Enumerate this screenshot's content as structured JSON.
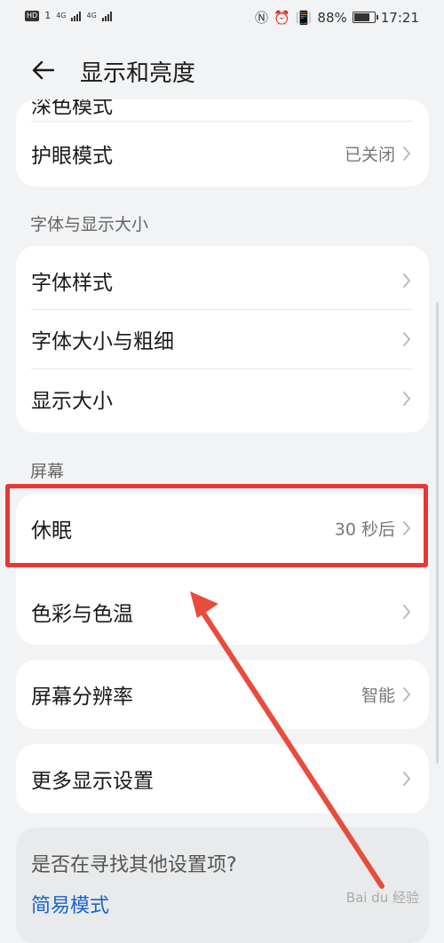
{
  "status_bar": {
    "hd": "HD",
    "sim1": "1",
    "net1": "4G",
    "net2": "4G",
    "battery_text": "88%",
    "battery_level": 0.88,
    "time": "17:21"
  },
  "header": {
    "title": "显示和亮度"
  },
  "cards": {
    "top": {
      "clipped_label": "深色模式",
      "eye_label": "护眼模式",
      "eye_value": "已关闭"
    },
    "font": {
      "section": "字体与显示大小",
      "items": [
        {
          "label": "字体样式"
        },
        {
          "label": "字体大小与粗细"
        },
        {
          "label": "显示大小"
        }
      ]
    },
    "screen": {
      "section": "屏幕",
      "sleep_label": "休眠",
      "sleep_value": "30 秒后",
      "color_label": "色彩与色温",
      "resolution_label": "屏幕分辨率",
      "resolution_value": "智能",
      "more_label": "更多显示设置"
    }
  },
  "help": {
    "question": "是否在寻找其他设置项?",
    "link": "简易模式"
  },
  "watermark": "Bai du 经验",
  "colors": {
    "highlight": "#e53935",
    "link": "#1a64c8",
    "background": "#f1f3f5"
  }
}
